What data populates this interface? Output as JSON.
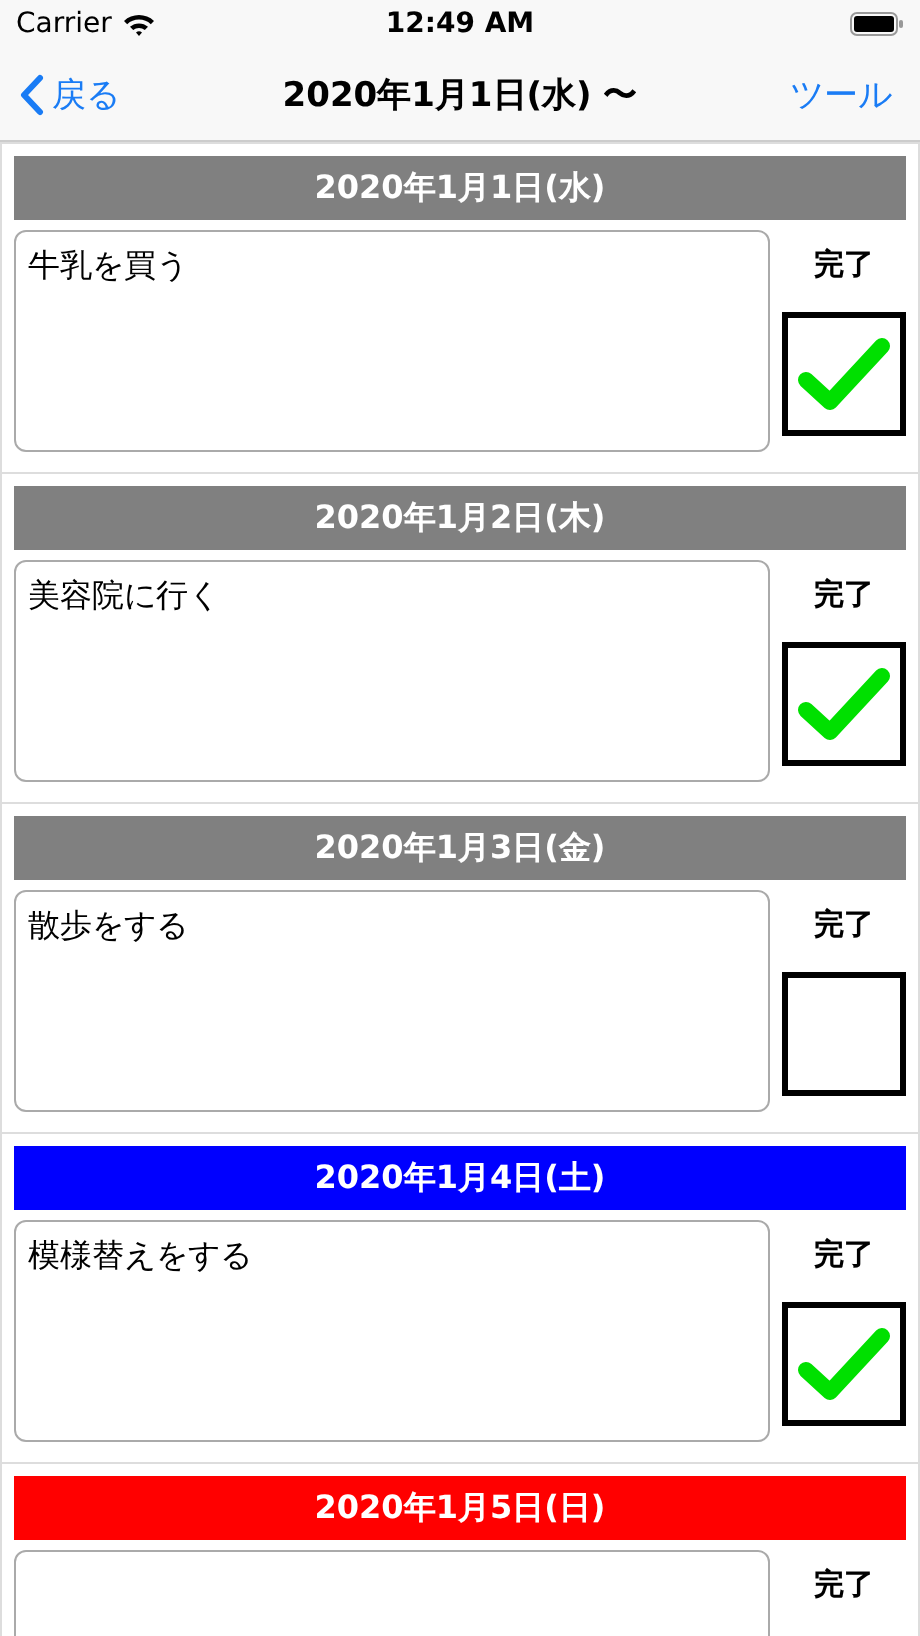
{
  "status_bar": {
    "carrier": "Carrier",
    "time": "12:49 AM"
  },
  "nav": {
    "back": "戻る",
    "title": "2020年1月1日(水) 〜",
    "action": "ツール"
  },
  "entries": [
    {
      "date": "2020年1月1日(水)",
      "color": "#808080",
      "note": "牛乳を買う",
      "done_label": "完了",
      "checked": true
    },
    {
      "date": "2020年1月2日(木)",
      "color": "#808080",
      "note": "美容院に行く",
      "done_label": "完了",
      "checked": true
    },
    {
      "date": "2020年1月3日(金)",
      "color": "#808080",
      "note": "散歩をする",
      "done_label": "完了",
      "checked": false
    },
    {
      "date": "2020年1月4日(土)",
      "color": "#0000ff",
      "note": "模様替えをする",
      "done_label": "完了",
      "checked": true
    },
    {
      "date": "2020年1月5日(日)",
      "color": "#ff0000",
      "done_label": "完了"
    }
  ]
}
